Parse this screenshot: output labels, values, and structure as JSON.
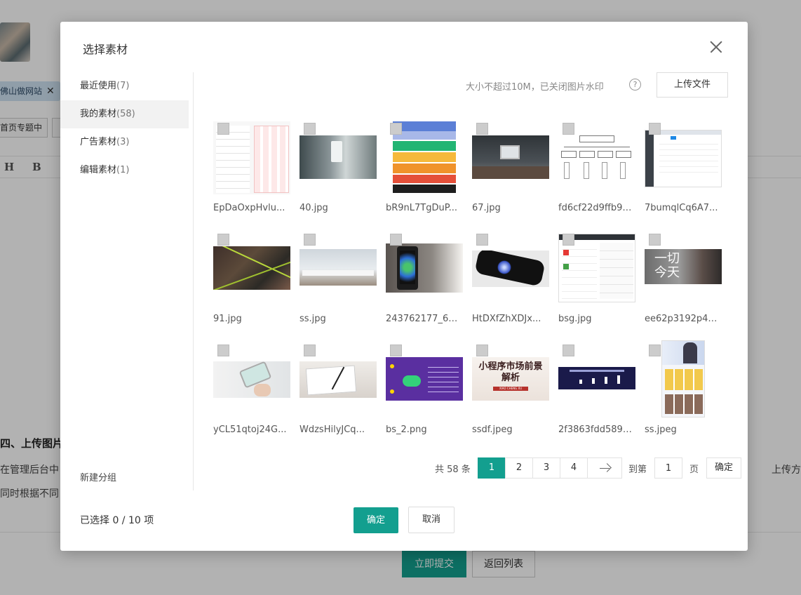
{
  "background": {
    "tag_label": "佛山做网站",
    "btn_label": "首页专题中",
    "toolbar": [
      "H",
      "B"
    ],
    "heading": "四、上传图片",
    "para1": "在管理后台中",
    "para2": "同时根据不同",
    "para_right": "上传方式。",
    "submit_label": "立即提交",
    "back_label": "返回列表"
  },
  "dialog": {
    "title": "选择素材",
    "categories": [
      {
        "label": "最近使用",
        "count": "(7)"
      },
      {
        "label": "我的素材",
        "count": "(58)"
      },
      {
        "label": "广告素材",
        "count": "(3)"
      },
      {
        "label": "编辑素材",
        "count": "(1)"
      }
    ],
    "new_group": "新建分组",
    "hint": "大小不超过10M，已关闭图片水印",
    "help": "?",
    "upload": "上传文件",
    "items": [
      "EpDaOxpHvlu...",
      "40.jpg",
      "bR9nL7TgDuP...",
      "67.jpg",
      "fd6cf22d9ffb92...",
      "7bumqlCq6A7...",
      "91.jpg",
      "ss.jpg",
      "243762177_6_...",
      "HtDXfZhXDJx...",
      "bsg.jpg",
      "ee62p3192p46...",
      "yCL51qtoj24G...",
      "WdzsHilyJCq...",
      "bs_2.png",
      "ssdf.jpeg",
      "2f3863fdd589b...",
      "ss.jpeg"
    ],
    "image_texts": {
      "promo": "小程序市场前景\n解析",
      "promo_sub": "XIAO CHENG XU",
      "quote": "一切\n今天"
    },
    "pager": {
      "total": "共 58 条",
      "pages": [
        "1",
        "2",
        "3",
        "4"
      ],
      "goto": "到第",
      "page_value": "1",
      "unit": "页",
      "ok": "确定"
    },
    "selected_label": "已选择",
    "selected_value": "0 / 10 项",
    "ok": "确定",
    "cancel": "取消"
  }
}
